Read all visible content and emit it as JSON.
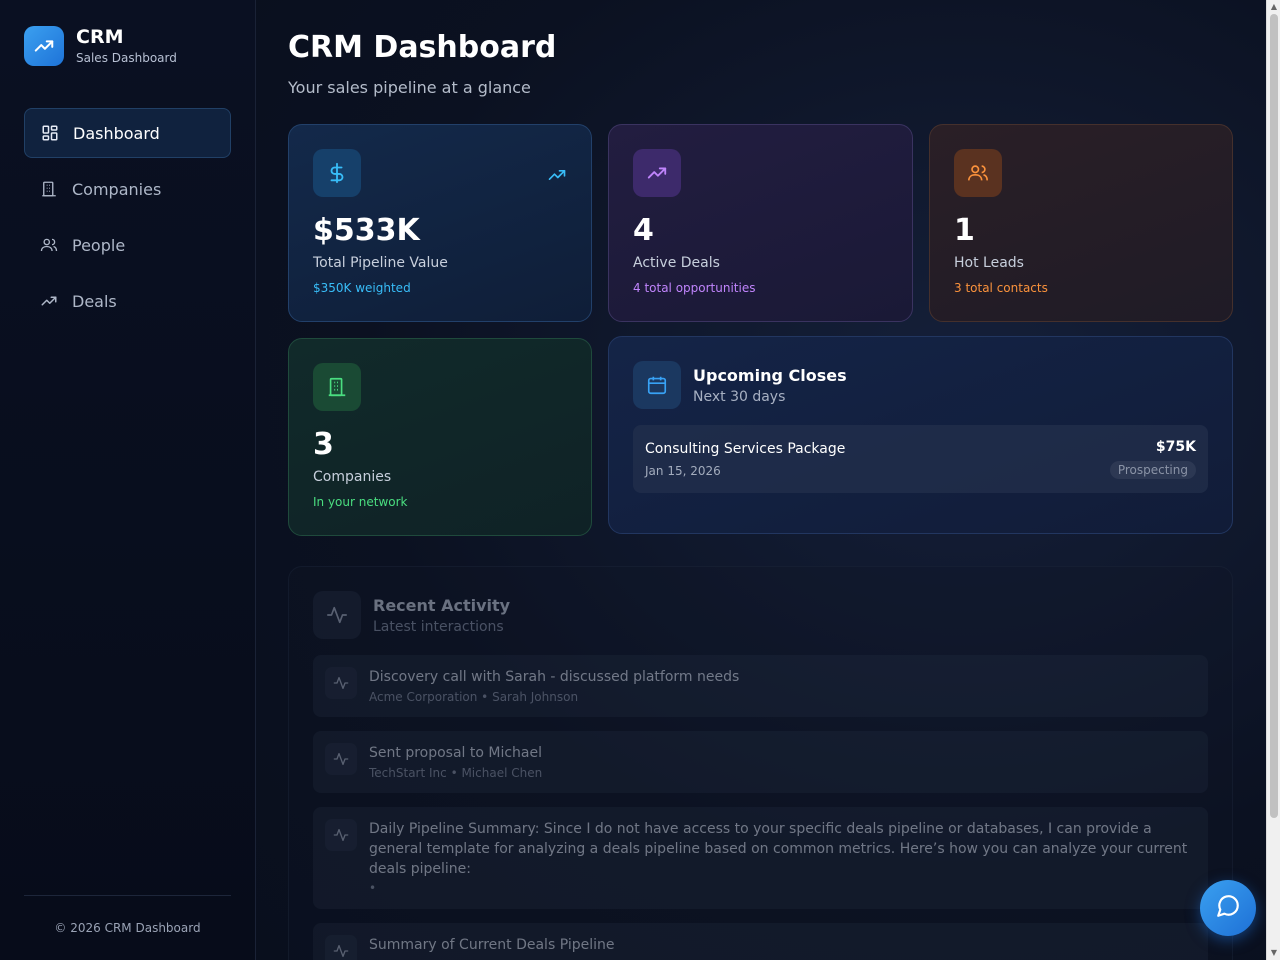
{
  "brand": {
    "title": "CRM",
    "subtitle": "Sales Dashboard"
  },
  "nav": {
    "items": [
      {
        "label": "Dashboard",
        "icon": "dashboard-grid-icon",
        "active": true
      },
      {
        "label": "Companies",
        "icon": "building-icon",
        "active": false
      },
      {
        "label": "People",
        "icon": "people-icon",
        "active": false
      },
      {
        "label": "Deals",
        "icon": "trend-up-icon",
        "active": false
      }
    ]
  },
  "footer": {
    "text": "© 2026 CRM Dashboard"
  },
  "page": {
    "title": "CRM Dashboard",
    "subtitle": "Your sales pipeline at a glance"
  },
  "stats": {
    "pipeline": {
      "value": "$533K",
      "label": "Total Pipeline Value",
      "note": "$350K weighted",
      "icon": "dollar-icon",
      "color": "#38bdf8"
    },
    "deals": {
      "value": "4",
      "label": "Active Deals",
      "note": "4 total opportunities",
      "icon": "trend-up-icon",
      "color": "#c084fc"
    },
    "leads": {
      "value": "1",
      "label": "Hot Leads",
      "note": "3 total contacts",
      "icon": "people-icon",
      "color": "#fb923c"
    },
    "companies": {
      "value": "3",
      "label": "Companies",
      "note": "In your network",
      "icon": "building-icon",
      "color": "#4ade80"
    }
  },
  "upcoming": {
    "title": "Upcoming Closes",
    "subtitle": "Next 30 days",
    "deals": [
      {
        "name": "Consulting Services Package",
        "date": "Jan 15, 2026",
        "value": "$75K",
        "stage": "Prospecting"
      }
    ]
  },
  "activity": {
    "title": "Recent Activity",
    "subtitle": "Latest interactions",
    "items": [
      {
        "title": "Discovery call with Sarah - discussed platform needs",
        "meta": "Acme Corporation • Sarah Johnson"
      },
      {
        "title": "Sent proposal to Michael",
        "meta": "TechStart Inc • Michael Chen"
      },
      {
        "title": "Daily Pipeline Summary: Since I do not have access to your specific deals pipeline or databases, I can provide a general template for analyzing a deals pipeline based on common metrics. Here’s how you can analyze your current deals pipeline:",
        "meta": "•"
      },
      {
        "title": "Summary of Current Deals Pipeline",
        "meta": ""
      }
    ]
  },
  "chat": {
    "icon": "chat-bubble-icon"
  }
}
